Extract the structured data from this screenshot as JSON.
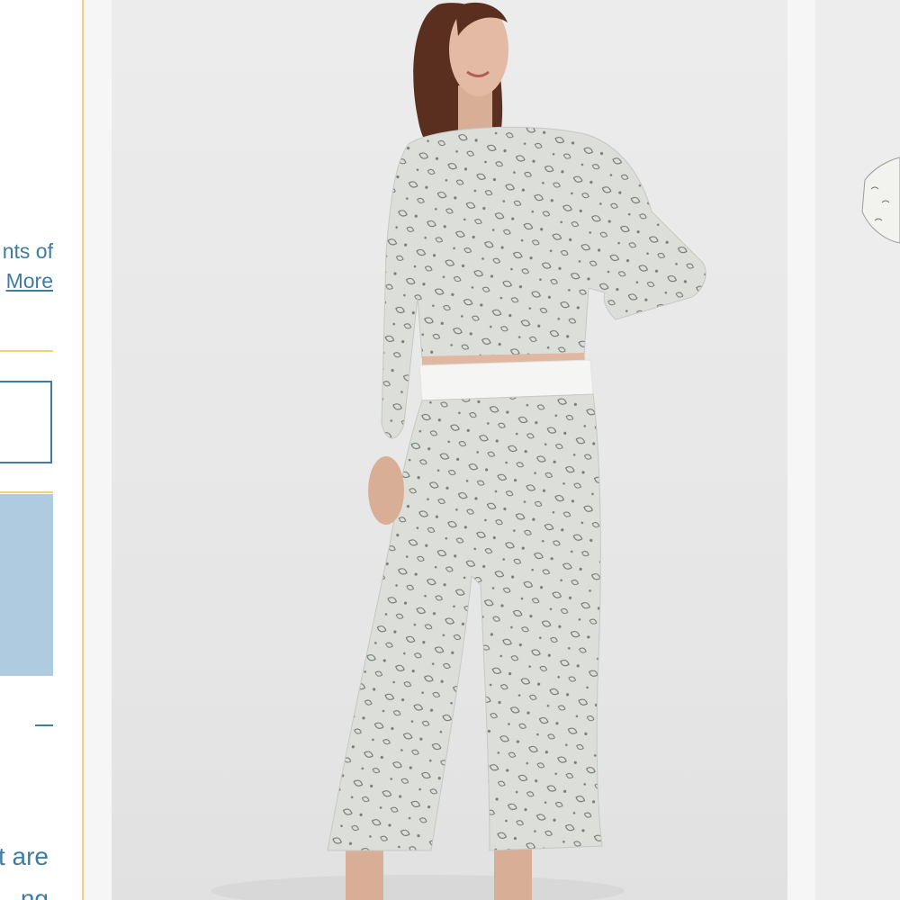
{
  "product_info": {
    "description_fragment": "nts of",
    "read_more_label": "More",
    "bottom_text_line1": "t are",
    "bottom_text_line2": "ng"
  },
  "gallery": {
    "main_image_alt": "Woman wearing light grey printed long-sleeve pajama top and wide-leg pants",
    "next_image_alt": "Next gallery image"
  },
  "colors": {
    "accent": "#3e7ca3",
    "accent_light": "#aecbe0",
    "divider_gold": "#f1d27a",
    "fabric": "#dcdfd9",
    "waistband": "#f5f5f3"
  },
  "icons": {
    "collapse": "minus-icon"
  }
}
